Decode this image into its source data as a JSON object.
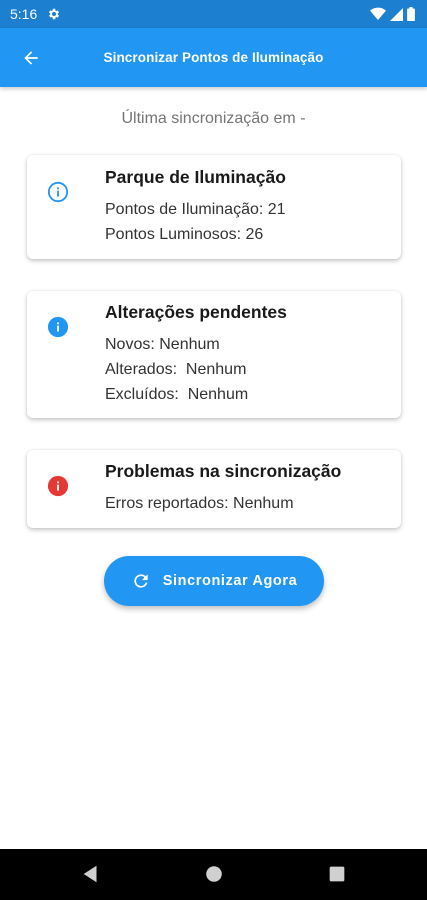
{
  "status_bar": {
    "time": "5:16",
    "icons": [
      "gear-icon",
      "wifi-icon",
      "signal-icon",
      "battery-icon"
    ]
  },
  "app_bar": {
    "title": "Sincronizar Pontos de Iluminação",
    "back_icon": "arrow-back-icon"
  },
  "last_sync": {
    "text": "Última sincronização em  -"
  },
  "cards": {
    "parque": {
      "icon": "info-outline-icon",
      "title": "Parque de Iluminação",
      "lines": [
        "Pontos de Iluminação: 21",
        "Pontos Luminosos: 26"
      ]
    },
    "pendentes": {
      "icon": "info-filled-icon",
      "title": "Alterações pendentes",
      "lines": [
        "Novos: Nenhum",
        "Alterados:  Nenhum",
        "Excluídos:  Nenhum"
      ]
    },
    "problemas": {
      "icon": "error-icon",
      "title": "Problemas na sincronização",
      "lines": [
        "Erros reportados: Nenhum"
      ]
    }
  },
  "sync_button": {
    "label": "Sincronizar Agora",
    "icon": "refresh-icon"
  },
  "nav_bar": {
    "buttons": [
      "back-triangle-icon",
      "home-circle-icon",
      "recents-square-icon"
    ]
  },
  "colors": {
    "primary": "#2196f3",
    "status_bar": "#1c7fd0",
    "error": "#e53935",
    "text_muted": "#757575"
  }
}
